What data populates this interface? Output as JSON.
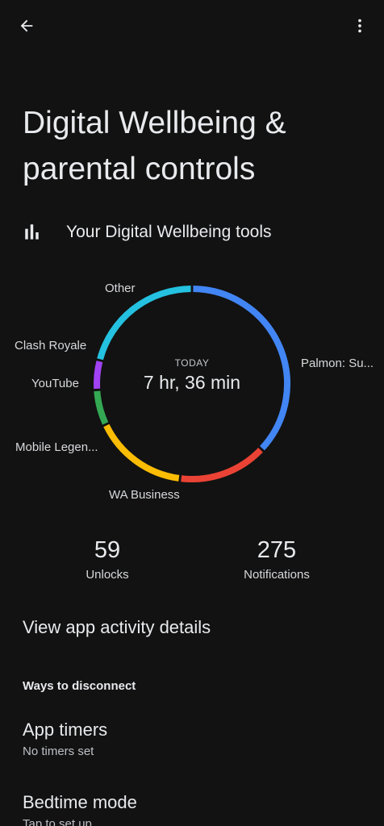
{
  "header": {
    "back_icon": "arrow-back-icon",
    "menu_icon": "more-vert-icon"
  },
  "page_title": "Digital Wellbeing & parental controls",
  "tools": {
    "icon": "bar-chart-icon",
    "label": "Your Digital Wellbeing tools"
  },
  "dashboard": {
    "period_label": "TODAY",
    "total_time": "7 hr, 36 min",
    "segments": [
      {
        "name": "Palmon: Su...",
        "color": "#4285f4",
        "share": 0.37
      },
      {
        "name": "WA Business",
        "color": "#ea4335",
        "share": 0.15
      },
      {
        "name": "Mobile Legen...",
        "color": "#fbbc04",
        "share": 0.16
      },
      {
        "name": "YouTube",
        "color": "#34a853",
        "share": 0.06
      },
      {
        "name": "Clash Royale",
        "color": "#a142f4",
        "share": 0.05
      },
      {
        "name": "Other",
        "color": "#24c1e0",
        "share": 0.21
      }
    ]
  },
  "stats": {
    "unlocks_value": "59",
    "unlocks_label": "Unlocks",
    "notifications_value": "275",
    "notifications_label": "Notifications"
  },
  "view_activity_label": "View app activity details",
  "ways_section": {
    "header": "Ways to disconnect",
    "app_timers_title": "App timers",
    "app_timers_sub": "No timers set",
    "bedtime_title": "Bedtime mode",
    "bedtime_sub": "Tap to set up"
  }
}
